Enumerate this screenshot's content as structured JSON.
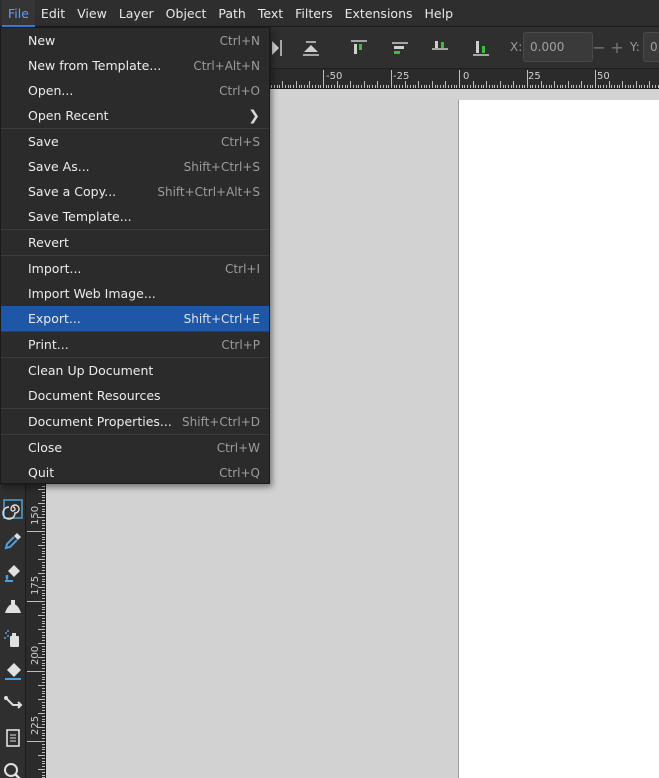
{
  "menubar": {
    "items": [
      "File",
      "Edit",
      "View",
      "Layer",
      "Object",
      "Path",
      "Text",
      "Filters",
      "Extensions",
      "Help"
    ],
    "active": "File"
  },
  "toolbar": {
    "x_label": "X:",
    "x_value": "0.000",
    "y_label": "Y:",
    "y_value": "0."
  },
  "hruler": {
    "labels": [
      "-50",
      "-25",
      "0",
      "25",
      "50"
    ]
  },
  "vruler": {
    "labels": [
      "150",
      "175",
      "200",
      "225"
    ]
  },
  "file_menu": {
    "items": [
      {
        "label": "New",
        "shortcut": "Ctrl+N"
      },
      {
        "label": "New from Template...",
        "shortcut": "Ctrl+Alt+N"
      },
      {
        "label": "Open...",
        "shortcut": "Ctrl+O"
      },
      {
        "label": "Open Recent",
        "shortcut": "",
        "submenu": true
      },
      {
        "label": "Save",
        "shortcut": "Ctrl+S"
      },
      {
        "label": "Save As...",
        "shortcut": "Shift+Ctrl+S"
      },
      {
        "label": "Save a Copy...",
        "shortcut": "Shift+Ctrl+Alt+S"
      },
      {
        "label": "Save Template...",
        "shortcut": ""
      },
      {
        "label": "Revert",
        "shortcut": ""
      },
      {
        "label": "Import...",
        "shortcut": "Ctrl+I"
      },
      {
        "label": "Import Web Image...",
        "shortcut": ""
      },
      {
        "label": "Export...",
        "shortcut": "Shift+Ctrl+E",
        "highlighted": true
      },
      {
        "label": "Print...",
        "shortcut": "Ctrl+P"
      },
      {
        "label": "Clean Up Document",
        "shortcut": ""
      },
      {
        "label": "Document Resources",
        "shortcut": ""
      },
      {
        "label": "Document Properties...",
        "shortcut": "Shift+Ctrl+D"
      },
      {
        "label": "Close",
        "shortcut": "Ctrl+W"
      },
      {
        "label": "Quit",
        "shortcut": "Ctrl+Q"
      }
    ]
  },
  "colors": {
    "accent": "#1e56a8",
    "menu_bg": "#2b2b2b",
    "canvas_bg": "#d2d2d2",
    "align_arrow": "#3bbf3b"
  },
  "icons": {
    "toolbar": [
      "align-flip-icon",
      "distribute-icon",
      "align-top-icon",
      "align-center-icon",
      "align-bottom-icon",
      "align-baseline-icon"
    ],
    "tools": [
      "spiral-icon",
      "dropper-icon",
      "paint-bucket-icon",
      "tweak-icon",
      "spray-icon",
      "eraser-icon",
      "connector-icon",
      "pages-icon",
      "zoom-icon"
    ]
  }
}
